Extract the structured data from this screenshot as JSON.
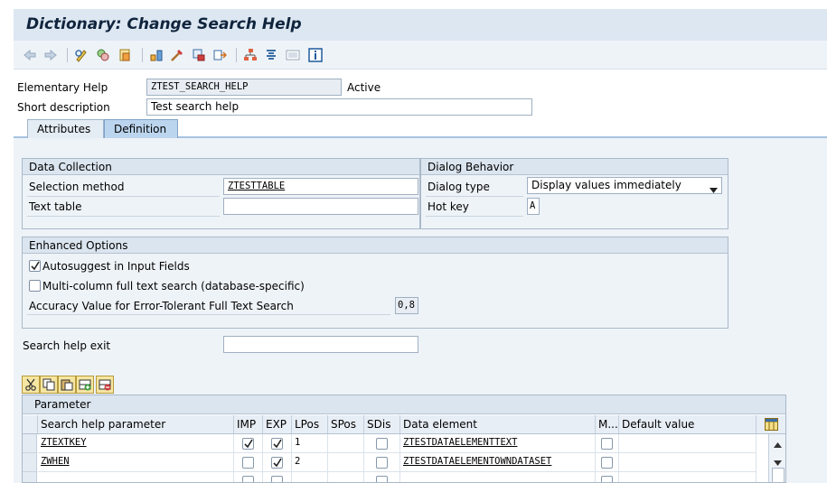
{
  "window": {
    "title": "Dictionary: Change Search Help"
  },
  "toolbar": {
    "icons": [
      "back-arrow-icon",
      "forward-arrow-icon",
      "display-change-icon",
      "other-object-icon",
      "activate-icon",
      "check-icon",
      "test-icon",
      "where-used-icon",
      "object-list-icon",
      "navigate-icon",
      "hierarchy-icon",
      "documentation-icon",
      "frame-icon",
      "info-icon"
    ]
  },
  "header": {
    "help_type_label": "Elementary Help",
    "help_name": "ZTEST_SEARCH_HELP",
    "status": "Active",
    "short_desc_label": "Short description",
    "short_desc_value": "Test search help"
  },
  "tabs": [
    {
      "label": "Attributes",
      "active": false
    },
    {
      "label": "Definition",
      "active": true
    }
  ],
  "data_collection": {
    "title": "Data Collection",
    "selection_method_label": "Selection method",
    "selection_method_value": "ZTESTTABLE",
    "text_table_label": "Text table",
    "text_table_value": ""
  },
  "dialog_behavior": {
    "title": "Dialog Behavior",
    "dialog_type_label": "Dialog type",
    "dialog_type_value": "Display values immediately",
    "hot_key_label": "Hot key",
    "hot_key_value": "A"
  },
  "enhanced_options": {
    "title": "Enhanced Options",
    "autosuggest_label": "Autosuggest in Input Fields",
    "autosuggest_checked": true,
    "multicolumn_label": "Multi-column full text search (database-specific)",
    "multicolumn_checked": false,
    "accuracy_label": "Accuracy Value for Error-Tolerant Full Text Search",
    "accuracy_value": "0,8"
  },
  "exit": {
    "label": "Search help exit",
    "value": ""
  },
  "table_toolbar": {
    "icons": [
      "cut-icon",
      "copy-icon",
      "paste-icon",
      "insert-row-icon",
      "delete-row-icon"
    ]
  },
  "parameter_table": {
    "caption": "Parameter",
    "columns": [
      "Search help parameter",
      "IMP",
      "EXP",
      "LPos",
      "SPos",
      "SDis",
      "Data element",
      "M...",
      "Default value"
    ],
    "rows": [
      {
        "param": "ZTEXTKEY",
        "imp": true,
        "exp": true,
        "lpos": "1",
        "spos": "",
        "sdis": false,
        "data_element": "ZTESTDATAELEMENTTEXT",
        "m": false,
        "default": ""
      },
      {
        "param": "ZWHEN",
        "imp": false,
        "exp": true,
        "lpos": "2",
        "spos": "",
        "sdis": false,
        "data_element": "ZTESTDATAELEMENTOWNDATASET",
        "m": false,
        "default": ""
      },
      {
        "param": "",
        "imp": false,
        "exp": false,
        "lpos": "",
        "spos": "",
        "sdis": false,
        "data_element": "",
        "m": false,
        "default": ""
      }
    ]
  }
}
